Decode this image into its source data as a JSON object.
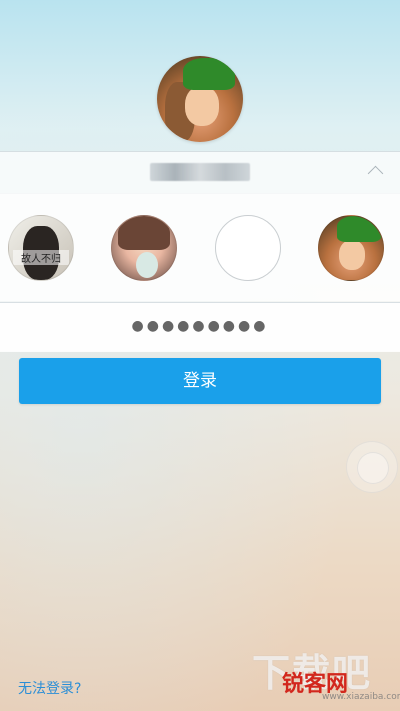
{
  "account": {
    "selected_name": "",
    "password_mask": "●●●●●●●●●",
    "saved_accounts": [
      {
        "overlay_text": "故人不归"
      },
      {
        "overlay_text": ""
      },
      {
        "overlay_text": ""
      },
      {
        "overlay_text": ""
      }
    ]
  },
  "login_button": {
    "label": "登录"
  },
  "cant_login_link": {
    "label": "无法登录?"
  },
  "watermark": {
    "big": "下载吧",
    "brand": "锐客网",
    "url": "www.xiazaiba.com"
  },
  "colors": {
    "accent": "#1aa0ea",
    "link": "#2b8ed6"
  }
}
